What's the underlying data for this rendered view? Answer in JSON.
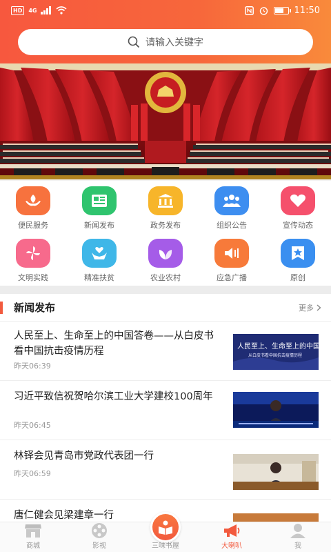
{
  "status_bar": {
    "hd": "HD",
    "network": "4G",
    "time": "11:50",
    "battery_level_percent": 60,
    "icons": [
      "signal-icon",
      "wifi-icon",
      "nfc-icon",
      "alarm-icon",
      "battery-icon"
    ]
  },
  "search": {
    "placeholder": "请输入关键字"
  },
  "grid": {
    "items": [
      {
        "label": "便民服务",
        "icon": "leaf-hands-icon",
        "color": "#f7723e"
      },
      {
        "label": "新闻发布",
        "icon": "newspaper-icon",
        "color": "#2fc46e"
      },
      {
        "label": "政务发布",
        "icon": "government-building-icon",
        "color": "#f7b52a"
      },
      {
        "label": "组织公告",
        "icon": "people-group-icon",
        "color": "#3d8ef0"
      },
      {
        "label": "宣传动态",
        "icon": "heart-icon",
        "color": "#f5506c"
      },
      {
        "label": "文明实践",
        "icon": "pinwheel-icon",
        "color": "#f76a8c"
      },
      {
        "label": "精准扶贫",
        "icon": "hand-heart-icon",
        "color": "#3fb7e8"
      },
      {
        "label": "农业农村",
        "icon": "sprout-icon",
        "color": "#a55ce8"
      },
      {
        "label": "应急广播",
        "icon": "speaker-icon",
        "color": "#f77a3a"
      },
      {
        "label": "原创",
        "icon": "star-badge-icon",
        "color": "#3a8ff0"
      }
    ]
  },
  "news": {
    "section_title": "新闻发布",
    "more_label": "更多",
    "items": [
      {
        "title": "人民至上、生命至上的中国答卷——从白皮书看中国抗击疫情历程",
        "time": "昨天06:39",
        "thumb_headline": "人民至上、生命至上的中国答卷",
        "thumb_sub": "从白皮书看中国抗击疫情历程"
      },
      {
        "title": "习近平致信祝贺哈尔滨工业大学建校100周年",
        "time": "昨天06:45"
      },
      {
        "title": "林铎会见青岛市党政代表团一行",
        "time": "昨天06:59"
      },
      {
        "title": "唐仁健会见梁建章一行",
        "time": ""
      }
    ]
  },
  "tabbar": {
    "tabs": [
      {
        "label": "商城",
        "icon": "shop-icon"
      },
      {
        "label": "影视",
        "icon": "film-reel-icon"
      },
      {
        "label": "三味书屋",
        "icon": "book-reader-icon"
      },
      {
        "label": "大喇叭",
        "icon": "megaphone-icon",
        "active": true
      },
      {
        "label": "我",
        "icon": "user-icon"
      }
    ]
  }
}
